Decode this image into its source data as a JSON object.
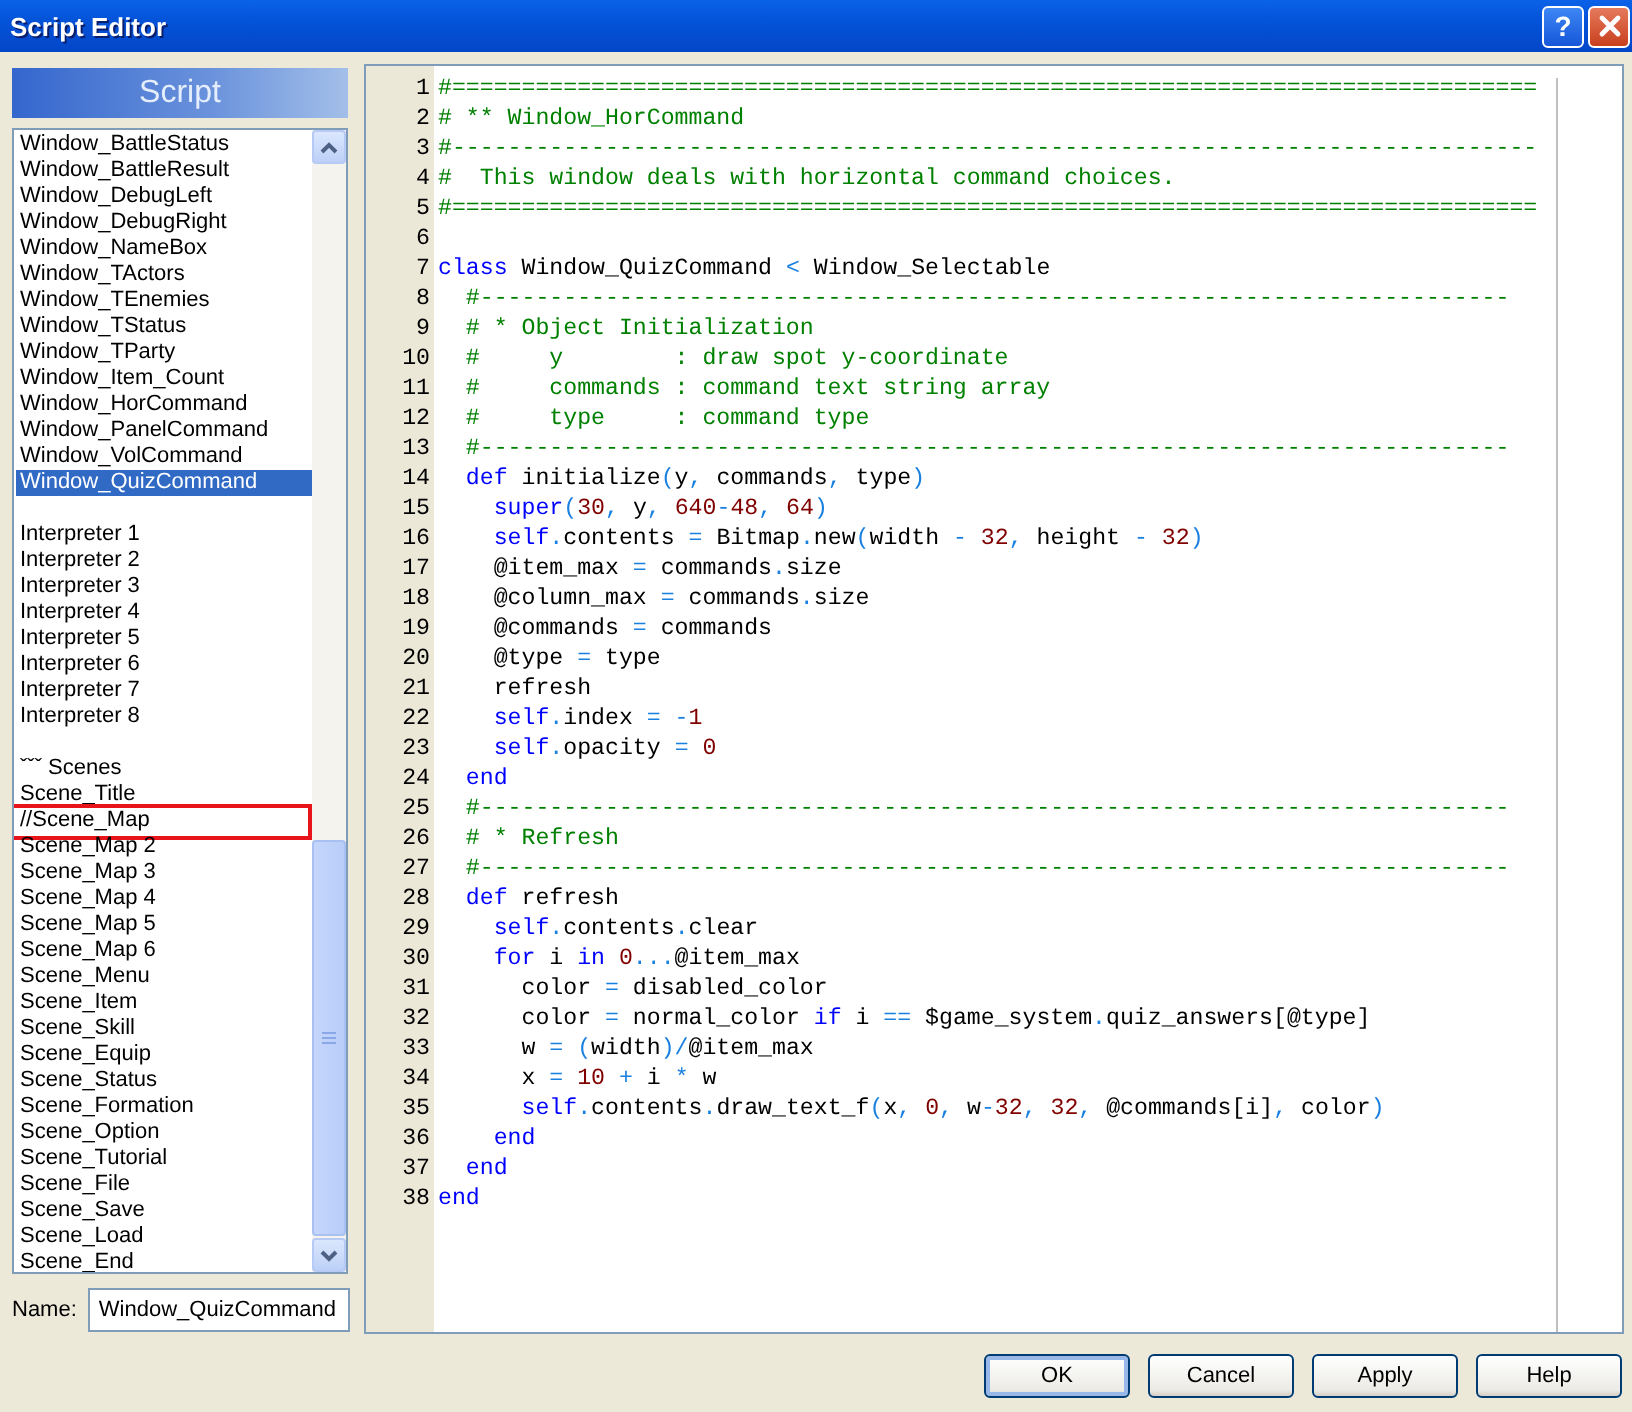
{
  "window": {
    "title": "Script Editor",
    "help_button": "?"
  },
  "sidebar": {
    "header": "Script",
    "groups": [
      [
        {
          "name": "Window_BattleStatus",
          "selected": false,
          "highlighted": false
        },
        {
          "name": "Window_BattleResult",
          "selected": false,
          "highlighted": false
        },
        {
          "name": "Window_DebugLeft",
          "selected": false,
          "highlighted": false
        },
        {
          "name": "Window_DebugRight",
          "selected": false,
          "highlighted": false
        },
        {
          "name": "Window_NameBox",
          "selected": false,
          "highlighted": false
        },
        {
          "name": "Window_TActors",
          "selected": false,
          "highlighted": false
        },
        {
          "name": "Window_TEnemies",
          "selected": false,
          "highlighted": false
        },
        {
          "name": "Window_TStatus",
          "selected": false,
          "highlighted": false
        },
        {
          "name": "Window_TParty",
          "selected": false,
          "highlighted": false
        },
        {
          "name": "Window_Item_Count",
          "selected": false,
          "highlighted": false
        },
        {
          "name": "Window_HorCommand",
          "selected": false,
          "highlighted": false
        },
        {
          "name": "Window_PanelCommand",
          "selected": false,
          "highlighted": false
        },
        {
          "name": "Window_VolCommand",
          "selected": false,
          "highlighted": false
        },
        {
          "name": "Window_QuizCommand",
          "selected": true,
          "highlighted": false
        }
      ],
      [
        {
          "name": "Interpreter 1",
          "selected": false,
          "highlighted": false
        },
        {
          "name": "Interpreter 2",
          "selected": false,
          "highlighted": false
        },
        {
          "name": "Interpreter 3",
          "selected": false,
          "highlighted": false
        },
        {
          "name": "Interpreter 4",
          "selected": false,
          "highlighted": false
        },
        {
          "name": "Interpreter 5",
          "selected": false,
          "highlighted": false
        },
        {
          "name": "Interpreter 6",
          "selected": false,
          "highlighted": false
        },
        {
          "name": "Interpreter 7",
          "selected": false,
          "highlighted": false
        },
        {
          "name": "Interpreter 8",
          "selected": false,
          "highlighted": false
        }
      ],
      [
        {
          "name": "ˇˇˇ Scenes",
          "selected": false,
          "highlighted": false
        },
        {
          "name": "Scene_Title",
          "selected": false,
          "highlighted": false
        },
        {
          "name": "//Scene_Map",
          "selected": false,
          "highlighted": true
        },
        {
          "name": "Scene_Map 2",
          "selected": false,
          "highlighted": false
        },
        {
          "name": "Scene_Map 3",
          "selected": false,
          "highlighted": false
        },
        {
          "name": "Scene_Map 4",
          "selected": false,
          "highlighted": false
        },
        {
          "name": "Scene_Map 5",
          "selected": false,
          "highlighted": false
        },
        {
          "name": "Scene_Map 6",
          "selected": false,
          "highlighted": false
        },
        {
          "name": "Scene_Menu",
          "selected": false,
          "highlighted": false
        },
        {
          "name": "Scene_Item",
          "selected": false,
          "highlighted": false
        },
        {
          "name": "Scene_Skill",
          "selected": false,
          "highlighted": false
        },
        {
          "name": "Scene_Equip",
          "selected": false,
          "highlighted": false
        },
        {
          "name": "Scene_Status",
          "selected": false,
          "highlighted": false
        },
        {
          "name": "Scene_Formation",
          "selected": false,
          "highlighted": false
        },
        {
          "name": "Scene_Option",
          "selected": false,
          "highlighted": false
        },
        {
          "name": "Scene_Tutorial",
          "selected": false,
          "highlighted": false
        },
        {
          "name": "Scene_File",
          "selected": false,
          "highlighted": false
        },
        {
          "name": "Scene_Save",
          "selected": false,
          "highlighted": false
        },
        {
          "name": "Scene_Load",
          "selected": false,
          "highlighted": false
        },
        {
          "name": "Scene_End",
          "selected": false,
          "highlighted": false
        }
      ]
    ],
    "name_field": {
      "label": "Name:",
      "value": "Window_QuizCommand"
    }
  },
  "editor": {
    "lines": [
      {
        "number": "1",
        "tokens": [
          {
            "text": "#==============================================================================",
            "kind": "comment"
          }
        ]
      },
      {
        "number": "2",
        "tokens": [
          {
            "text": "# ** Window_HorCommand",
            "kind": "comment"
          }
        ]
      },
      {
        "number": "3",
        "tokens": [
          {
            "text": "#------------------------------------------------------------------------------",
            "kind": "comment"
          }
        ]
      },
      {
        "number": "4",
        "tokens": [
          {
            "text": "#  This window deals with horizontal command choices.",
            "kind": "comment"
          }
        ]
      },
      {
        "number": "5",
        "tokens": [
          {
            "text": "#==============================================================================",
            "kind": "comment"
          }
        ]
      },
      {
        "number": "6"
      },
      {
        "number": "7",
        "tokens": [
          {
            "text": "class",
            "kind": "keyword"
          },
          {
            "text": " Window_QuizCommand ",
            "kind": "plain"
          },
          {
            "text": "<",
            "kind": "operator"
          },
          {
            "text": " Window_Selectable",
            "kind": "plain"
          }
        ]
      },
      {
        "number": "8",
        "tokens": [
          {
            "text": "  #--------------------------------------------------------------------------",
            "kind": "comment"
          }
        ]
      },
      {
        "number": "9",
        "tokens": [
          {
            "text": "  # * Object Initialization",
            "kind": "comment"
          }
        ]
      },
      {
        "number": "10",
        "tokens": [
          {
            "text": "  #     y        : draw spot y-coordinate",
            "kind": "comment"
          }
        ]
      },
      {
        "number": "11",
        "tokens": [
          {
            "text": "  #     commands : command text string array",
            "kind": "comment"
          }
        ]
      },
      {
        "number": "12",
        "tokens": [
          {
            "text": "  #     type     : command type",
            "kind": "comment"
          }
        ]
      },
      {
        "number": "13",
        "tokens": [
          {
            "text": "  #--------------------------------------------------------------------------",
            "kind": "comment"
          }
        ]
      },
      {
        "number": "14",
        "tokens": [
          {
            "text": "  def",
            "kind": "keyword"
          },
          {
            "text": " initialize",
            "kind": "plain"
          },
          {
            "text": "(",
            "kind": "operator"
          },
          {
            "text": "y",
            "kind": "plain"
          },
          {
            "text": ",",
            "kind": "operator"
          },
          {
            "text": " commands",
            "kind": "plain"
          },
          {
            "text": ",",
            "kind": "operator"
          },
          {
            "text": " type",
            "kind": "plain"
          },
          {
            "text": ")",
            "kind": "operator"
          }
        ]
      },
      {
        "number": "15",
        "tokens": [
          {
            "text": "    super",
            "kind": "keyword"
          },
          {
            "text": "(",
            "kind": "operator"
          },
          {
            "text": "30",
            "kind": "number"
          },
          {
            "text": ",",
            "kind": "operator"
          },
          {
            "text": " y",
            "kind": "plain"
          },
          {
            "text": ",",
            "kind": "operator"
          },
          {
            "text": " 640",
            "kind": "number"
          },
          {
            "text": "-",
            "kind": "operator"
          },
          {
            "text": "48",
            "kind": "number"
          },
          {
            "text": ",",
            "kind": "operator"
          },
          {
            "text": " 64",
            "kind": "number"
          },
          {
            "text": ")",
            "kind": "operator"
          }
        ]
      },
      {
        "number": "16",
        "tokens": [
          {
            "text": "    self",
            "kind": "keyword"
          },
          {
            "text": ".",
            "kind": "operator"
          },
          {
            "text": "contents ",
            "kind": "plain"
          },
          {
            "text": "=",
            "kind": "operator"
          },
          {
            "text": " Bitmap",
            "kind": "plain"
          },
          {
            "text": ".",
            "kind": "operator"
          },
          {
            "text": "new",
            "kind": "plain"
          },
          {
            "text": "(",
            "kind": "operator"
          },
          {
            "text": "width ",
            "kind": "plain"
          },
          {
            "text": "-",
            "kind": "operator"
          },
          {
            "text": " 32",
            "kind": "number"
          },
          {
            "text": ",",
            "kind": "operator"
          },
          {
            "text": " height ",
            "kind": "plain"
          },
          {
            "text": "-",
            "kind": "operator"
          },
          {
            "text": " 32",
            "kind": "number"
          },
          {
            "text": ")",
            "kind": "operator"
          }
        ]
      },
      {
        "number": "17",
        "tokens": [
          {
            "text": "    @item_max ",
            "kind": "plain"
          },
          {
            "text": "=",
            "kind": "operator"
          },
          {
            "text": " commands",
            "kind": "plain"
          },
          {
            "text": ".",
            "kind": "operator"
          },
          {
            "text": "size",
            "kind": "plain"
          }
        ]
      },
      {
        "number": "18",
        "tokens": [
          {
            "text": "    @column_max ",
            "kind": "plain"
          },
          {
            "text": "=",
            "kind": "operator"
          },
          {
            "text": " commands",
            "kind": "plain"
          },
          {
            "text": ".",
            "kind": "operator"
          },
          {
            "text": "size",
            "kind": "plain"
          }
        ]
      },
      {
        "number": "19",
        "tokens": [
          {
            "text": "    @commands ",
            "kind": "plain"
          },
          {
            "text": "=",
            "kind": "operator"
          },
          {
            "text": " commands",
            "kind": "plain"
          }
        ]
      },
      {
        "number": "20",
        "tokens": [
          {
            "text": "    @type ",
            "kind": "plain"
          },
          {
            "text": "=",
            "kind": "operator"
          },
          {
            "text": " type",
            "kind": "plain"
          }
        ]
      },
      {
        "number": "21",
        "tokens": [
          {
            "text": "    refresh",
            "kind": "plain"
          }
        ]
      },
      {
        "number": "22",
        "tokens": [
          {
            "text": "    self",
            "kind": "keyword"
          },
          {
            "text": ".",
            "kind": "operator"
          },
          {
            "text": "index ",
            "kind": "plain"
          },
          {
            "text": "= -",
            "kind": "operator"
          },
          {
            "text": "1",
            "kind": "number"
          }
        ]
      },
      {
        "number": "23",
        "tokens": [
          {
            "text": "    self",
            "kind": "keyword"
          },
          {
            "text": ".",
            "kind": "operator"
          },
          {
            "text": "opacity ",
            "kind": "plain"
          },
          {
            "text": "=",
            "kind": "operator"
          },
          {
            "text": " 0",
            "kind": "number"
          }
        ]
      },
      {
        "number": "24",
        "tokens": [
          {
            "text": "  end",
            "kind": "keyword"
          }
        ]
      },
      {
        "number": "25",
        "tokens": [
          {
            "text": "  #--------------------------------------------------------------------------",
            "kind": "comment"
          }
        ]
      },
      {
        "number": "26",
        "tokens": [
          {
            "text": "  # * Refresh",
            "kind": "comment"
          }
        ]
      },
      {
        "number": "27",
        "tokens": [
          {
            "text": "  #--------------------------------------------------------------------------",
            "kind": "comment"
          }
        ]
      },
      {
        "number": "28",
        "tokens": [
          {
            "text": "  def",
            "kind": "keyword"
          },
          {
            "text": " refresh",
            "kind": "plain"
          }
        ]
      },
      {
        "number": "29",
        "tokens": [
          {
            "text": "    self",
            "kind": "keyword"
          },
          {
            "text": ".",
            "kind": "operator"
          },
          {
            "text": "contents",
            "kind": "plain"
          },
          {
            "text": ".",
            "kind": "operator"
          },
          {
            "text": "clear",
            "kind": "plain"
          }
        ]
      },
      {
        "number": "30",
        "tokens": [
          {
            "text": "    for",
            "kind": "keyword"
          },
          {
            "text": " i ",
            "kind": "plain"
          },
          {
            "text": "in",
            "kind": "keyword"
          },
          {
            "text": " 0",
            "kind": "number"
          },
          {
            "text": "...",
            "kind": "operator"
          },
          {
            "text": "@item_max",
            "kind": "plain"
          }
        ]
      },
      {
        "number": "31",
        "tokens": [
          {
            "text": "      color ",
            "kind": "plain"
          },
          {
            "text": "=",
            "kind": "operator"
          },
          {
            "text": " disabled_color",
            "kind": "plain"
          }
        ]
      },
      {
        "number": "32",
        "tokens": [
          {
            "text": "      color ",
            "kind": "plain"
          },
          {
            "text": "=",
            "kind": "operator"
          },
          {
            "text": " normal_color ",
            "kind": "plain"
          },
          {
            "text": "if",
            "kind": "keyword"
          },
          {
            "text": " i ",
            "kind": "plain"
          },
          {
            "text": "==",
            "kind": "operator"
          },
          {
            "text": " $game_system",
            "kind": "plain"
          },
          {
            "text": ".",
            "kind": "operator"
          },
          {
            "text": "quiz_answers[@type]",
            "kind": "plain"
          }
        ]
      },
      {
        "number": "33",
        "tokens": [
          {
            "text": "      w ",
            "kind": "plain"
          },
          {
            "text": "= (",
            "kind": "operator"
          },
          {
            "text": "width",
            "kind": "plain"
          },
          {
            "text": ")/",
            "kind": "operator"
          },
          {
            "text": "@item_max",
            "kind": "plain"
          }
        ]
      },
      {
        "number": "34",
        "tokens": [
          {
            "text": "      x ",
            "kind": "plain"
          },
          {
            "text": "=",
            "kind": "operator"
          },
          {
            "text": " 10",
            "kind": "number"
          },
          {
            "text": " +",
            "kind": "operator"
          },
          {
            "text": " i ",
            "kind": "plain"
          },
          {
            "text": "*",
            "kind": "operator"
          },
          {
            "text": " w",
            "kind": "plain"
          }
        ]
      },
      {
        "number": "35",
        "tokens": [
          {
            "text": "      self",
            "kind": "keyword"
          },
          {
            "text": ".",
            "kind": "operator"
          },
          {
            "text": "contents",
            "kind": "plain"
          },
          {
            "text": ".",
            "kind": "operator"
          },
          {
            "text": "draw_text_f",
            "kind": "plain"
          },
          {
            "text": "(",
            "kind": "operator"
          },
          {
            "text": "x",
            "kind": "plain"
          },
          {
            "text": ",",
            "kind": "operator"
          },
          {
            "text": " 0",
            "kind": "number"
          },
          {
            "text": ",",
            "kind": "operator"
          },
          {
            "text": " w",
            "kind": "plain"
          },
          {
            "text": "-",
            "kind": "operator"
          },
          {
            "text": "32",
            "kind": "number"
          },
          {
            "text": ",",
            "kind": "operator"
          },
          {
            "text": " 32",
            "kind": "number"
          },
          {
            "text": ",",
            "kind": "operator"
          },
          {
            "text": " @commands[i]",
            "kind": "plain"
          },
          {
            "text": ",",
            "kind": "operator"
          },
          {
            "text": " color",
            "kind": "plain"
          },
          {
            "text": ")",
            "kind": "operator"
          }
        ]
      },
      {
        "number": "36",
        "tokens": [
          {
            "text": "    end",
            "kind": "keyword"
          }
        ]
      },
      {
        "number": "37",
        "tokens": [
          {
            "text": "  end",
            "kind": "keyword"
          }
        ]
      },
      {
        "number": "38",
        "tokens": [
          {
            "text": "end",
            "kind": "keyword"
          }
        ]
      }
    ]
  },
  "buttons": [
    {
      "label": "OK",
      "focused": true
    },
    {
      "label": "Cancel",
      "focused": false
    },
    {
      "label": "Apply",
      "focused": false
    },
    {
      "label": "Help",
      "focused": false
    }
  ]
}
